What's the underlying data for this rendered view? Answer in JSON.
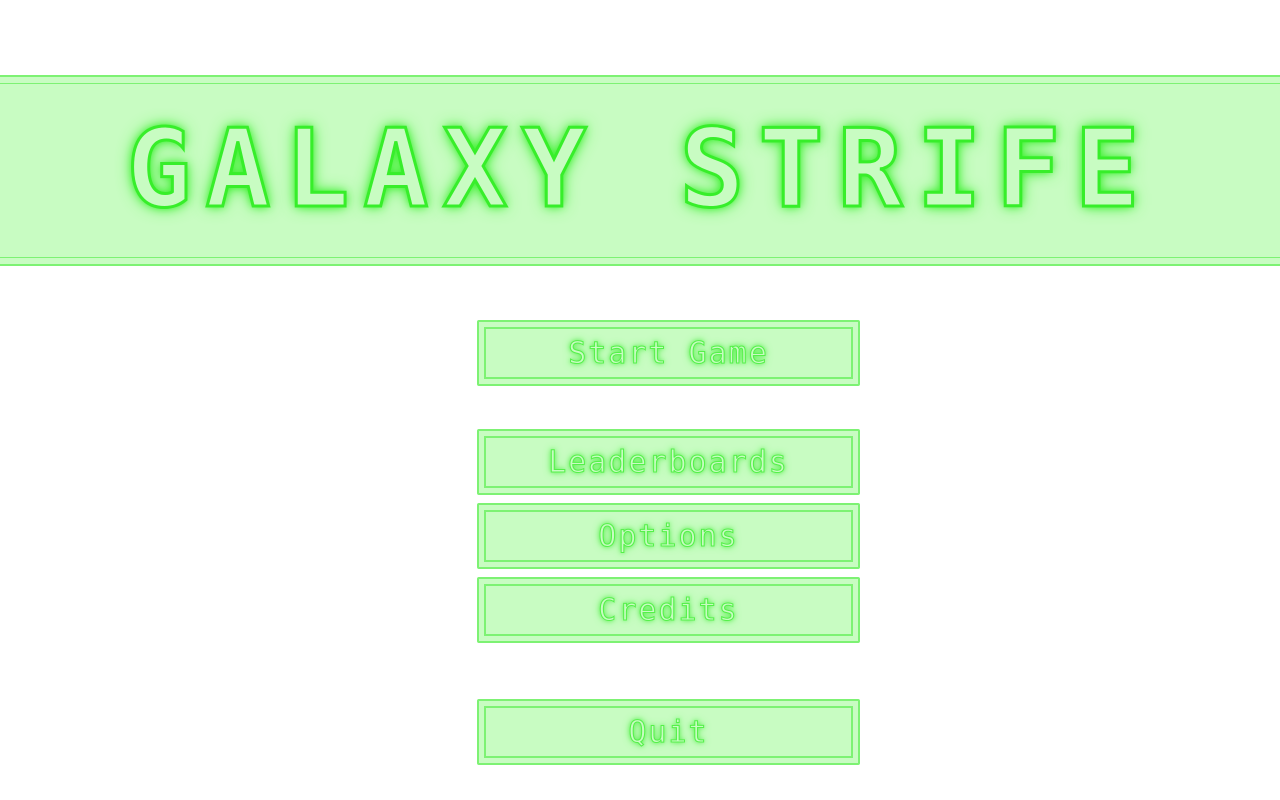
{
  "game": {
    "title": "GALAXY STRIFE"
  },
  "menu": {
    "start_label": "Start Game",
    "leaderboards_label": "Leaderboards",
    "options_label": "Options",
    "credits_label": "Credits",
    "quit_label": "Quit"
  },
  "colors": {
    "panel_fill": "#c8fcc2",
    "neon_green": "#37ee2a",
    "border_green": "#7df273",
    "background": "#ffffff"
  }
}
